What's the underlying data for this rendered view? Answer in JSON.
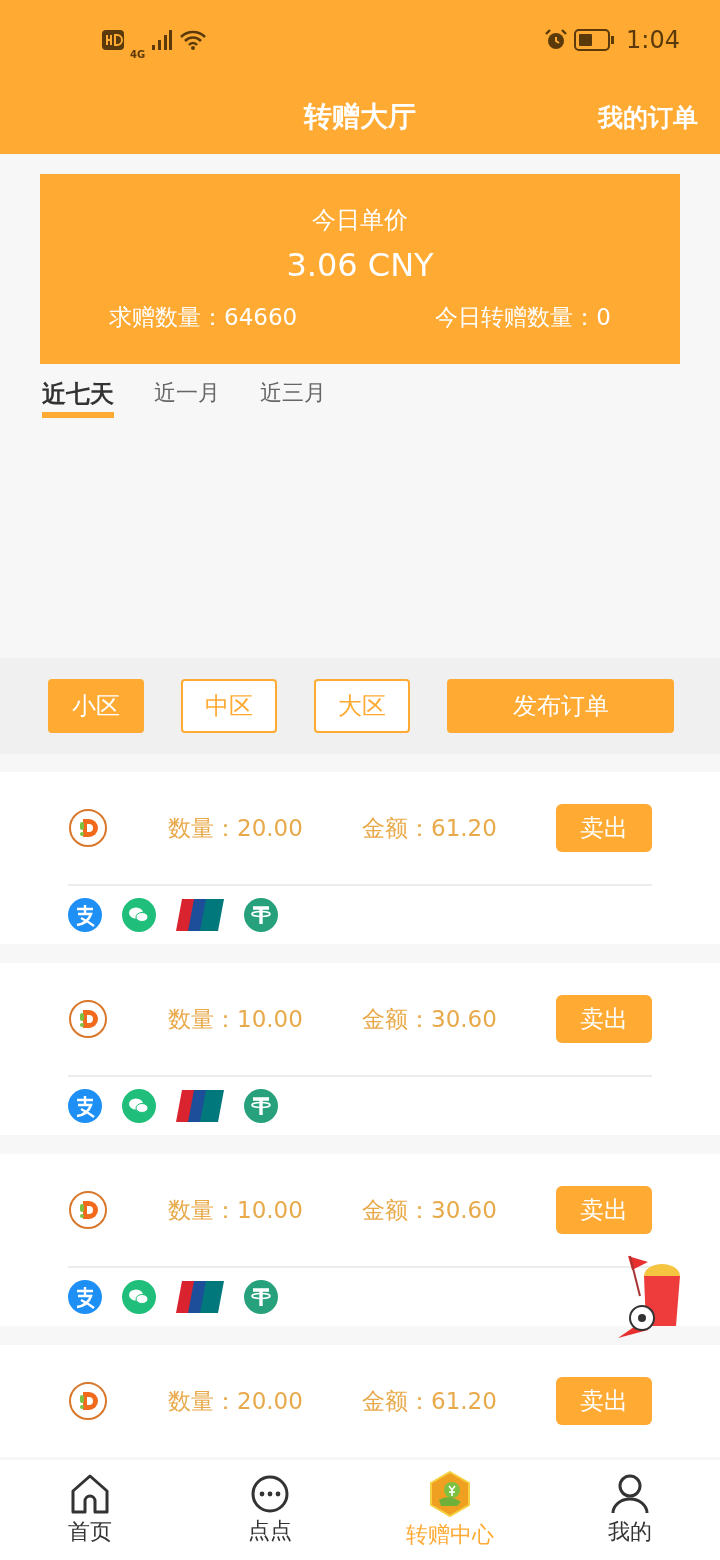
{
  "status_bar": {
    "time": "1:04",
    "network": "4G"
  },
  "header": {
    "title": "转赠大厅",
    "action": "我的订单"
  },
  "price_card": {
    "label": "今日单价",
    "price": "3.06 CNY",
    "stats": [
      {
        "label": "求赠数量：",
        "value": "64660"
      },
      {
        "label": "今日转赠数量：",
        "value": "0"
      }
    ]
  },
  "range_tabs": [
    {
      "label": "近七天",
      "selected": true
    },
    {
      "label": "近一月",
      "selected": false
    },
    {
      "label": "近三月",
      "selected": false
    }
  ],
  "zone_filters": [
    {
      "label": "小区",
      "selected": true
    },
    {
      "label": "中区",
      "selected": false
    },
    {
      "label": "大区",
      "selected": false
    }
  ],
  "publish_button": "发布订单",
  "orders": [
    {
      "quantity_label": "数量：",
      "quantity": "20.00",
      "amount_label": "金额：",
      "amount": "61.20",
      "action": "卖出",
      "payments": [
        {
          "kind": "alipay"
        },
        {
          "kind": "wechat"
        },
        {
          "kind": "unionpay"
        },
        {
          "kind": "tether"
        }
      ]
    },
    {
      "quantity_label": "数量：",
      "quantity": "10.00",
      "amount_label": "金额：",
      "amount": "30.60",
      "action": "卖出",
      "payments": [
        {
          "kind": "alipay"
        },
        {
          "kind": "wechat"
        },
        {
          "kind": "unionpay"
        },
        {
          "kind": "tether"
        }
      ]
    },
    {
      "quantity_label": "数量：",
      "quantity": "10.00",
      "amount_label": "金额：",
      "amount": "30.60",
      "action": "卖出",
      "payments": [
        {
          "kind": "alipay"
        },
        {
          "kind": "wechat"
        },
        {
          "kind": "unionpay"
        },
        {
          "kind": "tether"
        }
      ]
    },
    {
      "quantity_label": "数量：",
      "quantity": "20.00",
      "amount_label": "金额：",
      "amount": "61.20",
      "action": "卖出"
    }
  ],
  "tab_bar": [
    {
      "kind": "home",
      "label": "首页",
      "selected": false
    },
    {
      "kind": "chat",
      "label": "点点",
      "selected": false
    },
    {
      "kind": "transfer",
      "label": "转赠中心",
      "selected": true
    },
    {
      "kind": "user",
      "label": "我的",
      "selected": false
    }
  ]
}
